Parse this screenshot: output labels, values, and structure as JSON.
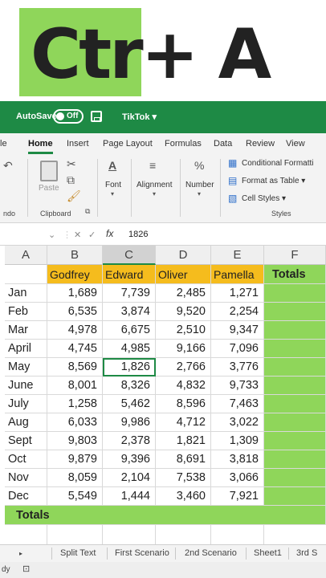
{
  "banner": {
    "text": "Ctr+ A"
  },
  "titlebar": {
    "autosave_label": "AutoSave",
    "toggle_state": "Off",
    "document_name": "TikTok ▾"
  },
  "ribbon_tabs": [
    "le",
    "Home",
    "Insert",
    "Page Layout",
    "Formulas",
    "Data",
    "Review",
    "View"
  ],
  "ribbon": {
    "paste": "Paste",
    "clipboard": "Clipboard",
    "undo_group": "ndo",
    "font": "Font",
    "alignment": "Alignment",
    "number": "Number",
    "conditional": "Conditional Formatti",
    "format_table": "Format as Table ▾",
    "cell_styles": "Cell Styles ▾",
    "styles": "Styles"
  },
  "formula_bar": {
    "fx": "fx",
    "value": "1826"
  },
  "columns": [
    "A",
    "B",
    "C",
    "D",
    "E",
    "F"
  ],
  "header_row": {
    "names": [
      "Godfrey",
      "Edward",
      "Oliver",
      "Pamella"
    ],
    "totals": "Totals"
  },
  "rows": [
    {
      "month": "Jan",
      "values": [
        "1,689",
        "7,739",
        "2,485",
        "1,271"
      ]
    },
    {
      "month": "Feb",
      "values": [
        "6,535",
        "3,874",
        "9,520",
        "2,254"
      ]
    },
    {
      "month": "Mar",
      "values": [
        "4,978",
        "6,675",
        "2,510",
        "9,347"
      ]
    },
    {
      "month": "April",
      "values": [
        "4,745",
        "4,985",
        "9,166",
        "7,096"
      ]
    },
    {
      "month": "May",
      "values": [
        "8,569",
        "1,826",
        "2,766",
        "3,776"
      ]
    },
    {
      "month": "June",
      "values": [
        "8,001",
        "8,326",
        "4,832",
        "9,733"
      ]
    },
    {
      "month": "July",
      "values": [
        "1,258",
        "5,462",
        "8,596",
        "7,463"
      ]
    },
    {
      "month": "Aug",
      "values": [
        "6,033",
        "9,986",
        "4,712",
        "3,022"
      ]
    },
    {
      "month": "Sept",
      "values": [
        "9,803",
        "2,378",
        "1,821",
        "1,309"
      ]
    },
    {
      "month": "Oct",
      "values": [
        "9,879",
        "9,396",
        "8,691",
        "3,818"
      ]
    },
    {
      "month": "Nov",
      "values": [
        "8,059",
        "2,104",
        "7,538",
        "3,066"
      ]
    },
    {
      "month": "Dec",
      "values": [
        "5,549",
        "1,444",
        "3,460",
        "7,921"
      ]
    }
  ],
  "totals_row_label": "Totals",
  "sheet_tabs": [
    "Split Text",
    "First Scenario",
    "2nd Scenario",
    "Sheet1",
    "3rd S"
  ],
  "status": {
    "ready": "dy"
  },
  "colors": {
    "green": "#1e8a45",
    "highlight_green": "#8fd65a",
    "header_yellow": "#f5bc1d"
  }
}
